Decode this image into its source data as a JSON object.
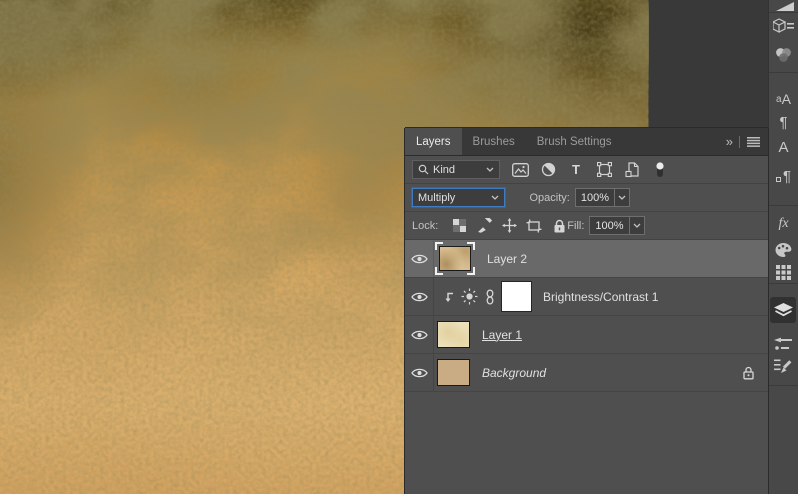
{
  "panel": {
    "tabs": [
      {
        "label": "Layers",
        "active": true
      },
      {
        "label": "Brushes",
        "active": false
      },
      {
        "label": "Brush Settings",
        "active": false
      }
    ],
    "collapse_glyph": "»",
    "menu_glyph": "≡",
    "filter": {
      "search_value": "Kind",
      "type_glyph": "T"
    },
    "blend": {
      "mode": "Multiply",
      "opacity_label": "Opacity:",
      "opacity_value": "100%"
    },
    "lock": {
      "label": "Lock:",
      "fill_label": "Fill:",
      "fill_value": "100%"
    },
    "layers": [
      {
        "name": "Layer 2",
        "visible": true,
        "selected": true,
        "kind": "pixel"
      },
      {
        "name": "Brightness/Contrast 1",
        "visible": true,
        "kind": "adjustment",
        "clipped": true
      },
      {
        "name": "Layer 1",
        "visible": true,
        "kind": "pixel",
        "clip_base": true
      },
      {
        "name": "Background",
        "visible": true,
        "kind": "background",
        "locked": true
      }
    ]
  },
  "dock": {
    "glyph_a_small": "a",
    "glyph_a_big": "A",
    "paragraph_glyph": "¶",
    "character_glyph": "A",
    "fx_glyph": "fx",
    "items": [
      "libraries",
      "color",
      "glyphs",
      "paragraph",
      "character",
      "paragraph-styles",
      "styles",
      "swatches",
      "patterns",
      "layers",
      "brushes",
      "brush-settings"
    ],
    "active_item": "layers"
  },
  "colors": {
    "accent_blue": "#3e7cc4",
    "panel_bg": "#4f4f4f",
    "selected_row": "#696969",
    "workspace_bg": "#393939",
    "dock_bg": "#484848",
    "canvas_amber": "#d2a45f",
    "canvas_dark_olive": "#4e431c",
    "thumb_tan": "#d9bd90",
    "thumb_cream": "#ece0ba",
    "thumb_background_fill": "#c9ac83"
  }
}
